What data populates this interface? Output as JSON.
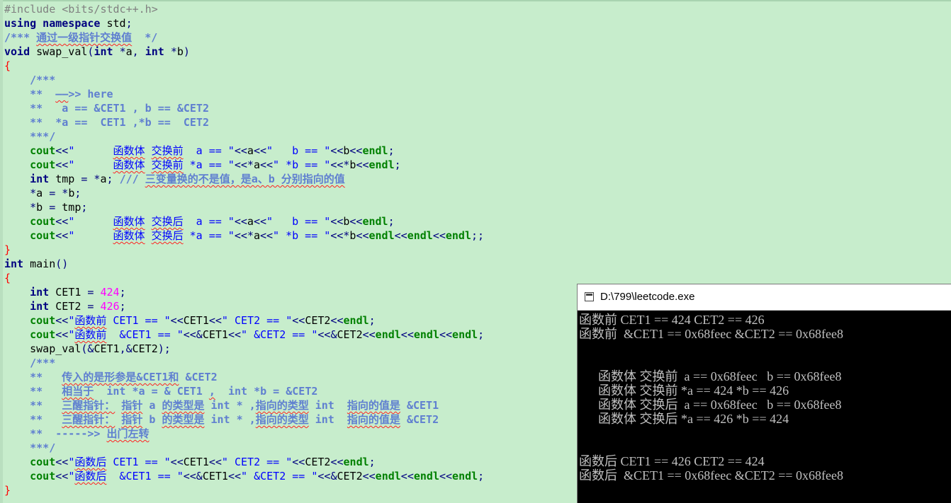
{
  "editor": {
    "lines": [
      [
        [
          "pre",
          "#include <bits/stdc++.h>"
        ]
      ],
      [
        [
          "kw",
          "using namespace "
        ],
        [
          "id",
          "std"
        ],
        [
          "op",
          ";"
        ]
      ],
      [
        [
          "cm",
          "/*** "
        ],
        [
          "cm sq",
          "通过一级指针交换值"
        ],
        [
          "cm",
          "  */"
        ]
      ],
      [
        [
          "kw",
          "void "
        ],
        [
          "id",
          "swap_val"
        ],
        [
          "op",
          "("
        ],
        [
          "kw",
          "int "
        ],
        [
          "op",
          "*"
        ],
        [
          "id",
          "a"
        ],
        [
          "op",
          ", "
        ],
        [
          "kw",
          "int "
        ],
        [
          "op",
          "*"
        ],
        [
          "id",
          "b"
        ],
        [
          "op",
          ")"
        ]
      ],
      [
        [
          "brace",
          "{"
        ]
      ],
      [
        [
          "cm",
          "    /***"
        ]
      ],
      [
        [
          "cm",
          "    **  "
        ],
        [
          "cm sq",
          "——"
        ],
        [
          "cm",
          ">> here"
        ]
      ],
      [
        [
          "cm",
          "    **   a == &CET1 , b == &CET2"
        ]
      ],
      [
        [
          "cm",
          "    **  *a ==  CET1 ,*b ==  CET2"
        ]
      ],
      [
        [
          "cm",
          "    ***/"
        ]
      ],
      [
        [
          "cout",
          "    cout"
        ],
        [
          "op",
          "<<"
        ],
        [
          "strs",
          "\"      "
        ],
        [
          "strs sq",
          "函数体"
        ],
        [
          "strs",
          " "
        ],
        [
          "strs sq",
          "交换前"
        ],
        [
          "strs",
          "  a == \""
        ],
        [
          "op",
          "<<"
        ],
        [
          "id",
          "a"
        ],
        [
          "op",
          "<<"
        ],
        [
          "strs",
          "\"   b == \""
        ],
        [
          "op",
          "<<"
        ],
        [
          "id",
          "b"
        ],
        [
          "op",
          "<<"
        ],
        [
          "endl",
          "endl"
        ],
        [
          "op",
          ";"
        ]
      ],
      [
        [
          "cout",
          "    cout"
        ],
        [
          "op",
          "<<"
        ],
        [
          "strs",
          "\"      "
        ],
        [
          "strs sq",
          "函数体"
        ],
        [
          "strs",
          " "
        ],
        [
          "strs sq",
          "交换前"
        ],
        [
          "strs",
          " *a == \""
        ],
        [
          "op",
          "<<*"
        ],
        [
          "id",
          "a"
        ],
        [
          "op",
          "<<"
        ],
        [
          "strs",
          "\" *b == \""
        ],
        [
          "op",
          "<<*"
        ],
        [
          "id",
          "b"
        ],
        [
          "op",
          "<<"
        ],
        [
          "endl",
          "endl"
        ],
        [
          "op",
          ";"
        ]
      ],
      [
        [
          "kw",
          "    int "
        ],
        [
          "id",
          "tmp "
        ],
        [
          "op",
          "= *"
        ],
        [
          "id",
          "a"
        ],
        [
          "op",
          "; "
        ],
        [
          "cm",
          "/// "
        ],
        [
          "cm sq",
          "三变量换的不是值，是a、b 分别指向的值"
        ]
      ],
      [
        [
          "op",
          "    *"
        ],
        [
          "id",
          "a "
        ],
        [
          "op",
          "= *"
        ],
        [
          "id",
          "b"
        ],
        [
          "op",
          ";"
        ]
      ],
      [
        [
          "op",
          "    *"
        ],
        [
          "id",
          "b "
        ],
        [
          "op",
          "= "
        ],
        [
          "id",
          "tmp"
        ],
        [
          "op",
          ";"
        ]
      ],
      [
        [
          "cout",
          "    cout"
        ],
        [
          "op",
          "<<"
        ],
        [
          "strs",
          "\"      "
        ],
        [
          "strs sq",
          "函数体"
        ],
        [
          "strs",
          " "
        ],
        [
          "strs sq",
          "交换后"
        ],
        [
          "strs",
          "  a == \""
        ],
        [
          "op",
          "<<"
        ],
        [
          "id",
          "a"
        ],
        [
          "op",
          "<<"
        ],
        [
          "strs",
          "\"   b == \""
        ],
        [
          "op",
          "<<"
        ],
        [
          "id",
          "b"
        ],
        [
          "op",
          "<<"
        ],
        [
          "endl",
          "endl"
        ],
        [
          "op",
          ";"
        ]
      ],
      [
        [
          "cout",
          "    cout"
        ],
        [
          "op",
          "<<"
        ],
        [
          "strs",
          "\"      "
        ],
        [
          "strs sq",
          "函数体"
        ],
        [
          "strs",
          " "
        ],
        [
          "strs sq",
          "交换后"
        ],
        [
          "strs",
          " *a == \""
        ],
        [
          "op",
          "<<*"
        ],
        [
          "id",
          "a"
        ],
        [
          "op",
          "<<"
        ],
        [
          "strs",
          "\" *b == \""
        ],
        [
          "op",
          "<<*"
        ],
        [
          "id",
          "b"
        ],
        [
          "op",
          "<<"
        ],
        [
          "endl",
          "endl"
        ],
        [
          "op",
          "<<"
        ],
        [
          "endl",
          "endl"
        ],
        [
          "op",
          "<<"
        ],
        [
          "endl",
          "endl"
        ],
        [
          "op",
          ";;"
        ]
      ],
      [
        [
          "brace",
          "}"
        ]
      ],
      [
        [
          "kw",
          "int "
        ],
        [
          "id",
          "main"
        ],
        [
          "op",
          "()"
        ]
      ],
      [
        [
          "brace",
          "{"
        ]
      ],
      [
        [
          "kw",
          "    int "
        ],
        [
          "id",
          "CET1 "
        ],
        [
          "op",
          "= "
        ],
        [
          "num",
          "424"
        ],
        [
          "op",
          ";"
        ]
      ],
      [
        [
          "kw",
          "    int "
        ],
        [
          "id",
          "CET2 "
        ],
        [
          "op",
          "= "
        ],
        [
          "num",
          "426"
        ],
        [
          "op",
          ";"
        ]
      ],
      [
        [
          "cout",
          "    cout"
        ],
        [
          "op",
          "<<"
        ],
        [
          "strs",
          "\""
        ],
        [
          "strs sq",
          "函数前"
        ],
        [
          "strs",
          " CET1 == \""
        ],
        [
          "op",
          "<<"
        ],
        [
          "id",
          "CET1"
        ],
        [
          "op",
          "<<"
        ],
        [
          "strs",
          "\" CET2 == \""
        ],
        [
          "op",
          "<<"
        ],
        [
          "id",
          "CET2"
        ],
        [
          "op",
          "<<"
        ],
        [
          "endl",
          "endl"
        ],
        [
          "op",
          ";"
        ]
      ],
      [
        [
          "cout",
          "    cout"
        ],
        [
          "op",
          "<<"
        ],
        [
          "strs",
          "\""
        ],
        [
          "strs sq",
          "函数前"
        ],
        [
          "strs",
          "  &CET1 == \""
        ],
        [
          "op",
          "<<&"
        ],
        [
          "id",
          "CET1"
        ],
        [
          "op",
          "<<"
        ],
        [
          "strs",
          "\" &CET2 == \""
        ],
        [
          "op",
          "<<&"
        ],
        [
          "id",
          "CET2"
        ],
        [
          "op",
          "<<"
        ],
        [
          "endl",
          "endl"
        ],
        [
          "op",
          "<<"
        ],
        [
          "endl",
          "endl"
        ],
        [
          "op",
          "<<"
        ],
        [
          "endl",
          "endl"
        ],
        [
          "op",
          ";"
        ]
      ],
      [
        [
          "id",
          "    swap_val"
        ],
        [
          "op",
          "(&"
        ],
        [
          "id",
          "CET1"
        ],
        [
          "op",
          ",&"
        ],
        [
          "id",
          "CET2"
        ],
        [
          "op",
          ");"
        ]
      ],
      [
        [
          "cm",
          "    /***"
        ]
      ],
      [
        [
          "cm",
          "    **   "
        ],
        [
          "cm sq",
          "传入的是形参是&CET1和"
        ],
        [
          "cm",
          " &CET2"
        ]
      ],
      [
        [
          "cm",
          "    **   "
        ],
        [
          "cm sq",
          "相当于"
        ],
        [
          "cm",
          "  int *a = & CET1 "
        ],
        [
          "cm sq",
          ","
        ],
        [
          "cm",
          "  int *b = &CET2"
        ]
      ],
      [
        [
          "cm",
          "    **   "
        ],
        [
          "cm sq",
          "三醒指针："
        ],
        [
          "cm",
          " "
        ],
        [
          "cm sq",
          "指针"
        ],
        [
          "cm",
          " a "
        ],
        [
          "cm sq",
          "的类型是"
        ],
        [
          "cm",
          " int * ,"
        ],
        [
          "cm sq",
          "指向的类型"
        ],
        [
          "cm",
          " int  "
        ],
        [
          "cm sq",
          "指向的值是"
        ],
        [
          "cm",
          " &CET1"
        ]
      ],
      [
        [
          "cm",
          "    **   "
        ],
        [
          "cm sq",
          "三醒指针："
        ],
        [
          "cm",
          " "
        ],
        [
          "cm sq",
          "指针"
        ],
        [
          "cm",
          " b "
        ],
        [
          "cm sq",
          "的类型是"
        ],
        [
          "cm",
          " int * ,"
        ],
        [
          "cm sq",
          "指向的类型"
        ],
        [
          "cm",
          " int  "
        ],
        [
          "cm sq",
          "指向的值是"
        ],
        [
          "cm",
          " &CET2"
        ]
      ],
      [
        [
          "cm",
          "    **  ----->> "
        ],
        [
          "cm sq",
          "出门左转"
        ]
      ],
      [
        [
          "cm",
          "    ***/"
        ]
      ],
      [
        [
          "cout",
          "    cout"
        ],
        [
          "op",
          "<<"
        ],
        [
          "strs",
          "\""
        ],
        [
          "strs sq",
          "函数后"
        ],
        [
          "strs",
          " CET1 == \""
        ],
        [
          "op",
          "<<"
        ],
        [
          "id",
          "CET1"
        ],
        [
          "op",
          "<<"
        ],
        [
          "strs",
          "\" CET2 == \""
        ],
        [
          "op",
          "<<"
        ],
        [
          "id",
          "CET2"
        ],
        [
          "op",
          "<<"
        ],
        [
          "endl",
          "endl"
        ],
        [
          "op",
          ";"
        ]
      ],
      [
        [
          "cout",
          "    cout"
        ],
        [
          "op",
          "<<"
        ],
        [
          "strs",
          "\""
        ],
        [
          "strs sq",
          "函数后"
        ],
        [
          "strs",
          "  &CET1 == \""
        ],
        [
          "op",
          "<<&"
        ],
        [
          "id",
          "CET1"
        ],
        [
          "op",
          "<<"
        ],
        [
          "strs",
          "\" &CET2 == \""
        ],
        [
          "op",
          "<<&"
        ],
        [
          "id",
          "CET2"
        ],
        [
          "op",
          "<<"
        ],
        [
          "endl",
          "endl"
        ],
        [
          "op",
          "<<"
        ],
        [
          "endl",
          "endl"
        ],
        [
          "op",
          "<<"
        ],
        [
          "endl",
          "endl"
        ],
        [
          "op",
          ";"
        ]
      ],
      [
        [
          "brace",
          "}"
        ]
      ]
    ]
  },
  "console": {
    "title": "D:\\799\\leetcode.exe",
    "lines": [
      "函数前 CET1 == 424 CET2 == 426",
      "函数前  &CET1 == 0x68feec &CET2 == 0x68fee8",
      "",
      "",
      "      函数体 交换前  a == 0x68feec   b == 0x68fee8",
      "      函数体 交换前 *a == 424 *b == 426",
      "      函数体 交换后  a == 0x68feec   b == 0x68fee8",
      "      函数体 交换后 *a == 426 *b == 424",
      "",
      "",
      "函数后 CET1 == 426 CET2 == 424",
      "函数后  &CET1 == 0x68feec &CET2 == 0x68fee8"
    ]
  }
}
